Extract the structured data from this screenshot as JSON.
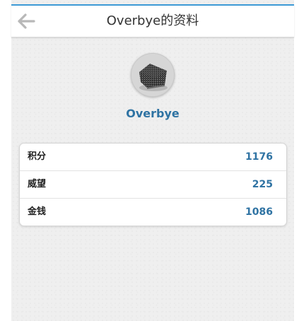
{
  "header": {
    "title": "Overbye的资料",
    "back_icon": "arrow-left-icon",
    "accent_color": "#3d9ad6"
  },
  "profile": {
    "username": "Overbye",
    "avatar_icon": "avatar-image",
    "name_color": "#2f73a3"
  },
  "stats": [
    {
      "label": "积分",
      "value": "1176"
    },
    {
      "label": "威望",
      "value": "225"
    },
    {
      "label": "金钱",
      "value": "1086"
    }
  ]
}
